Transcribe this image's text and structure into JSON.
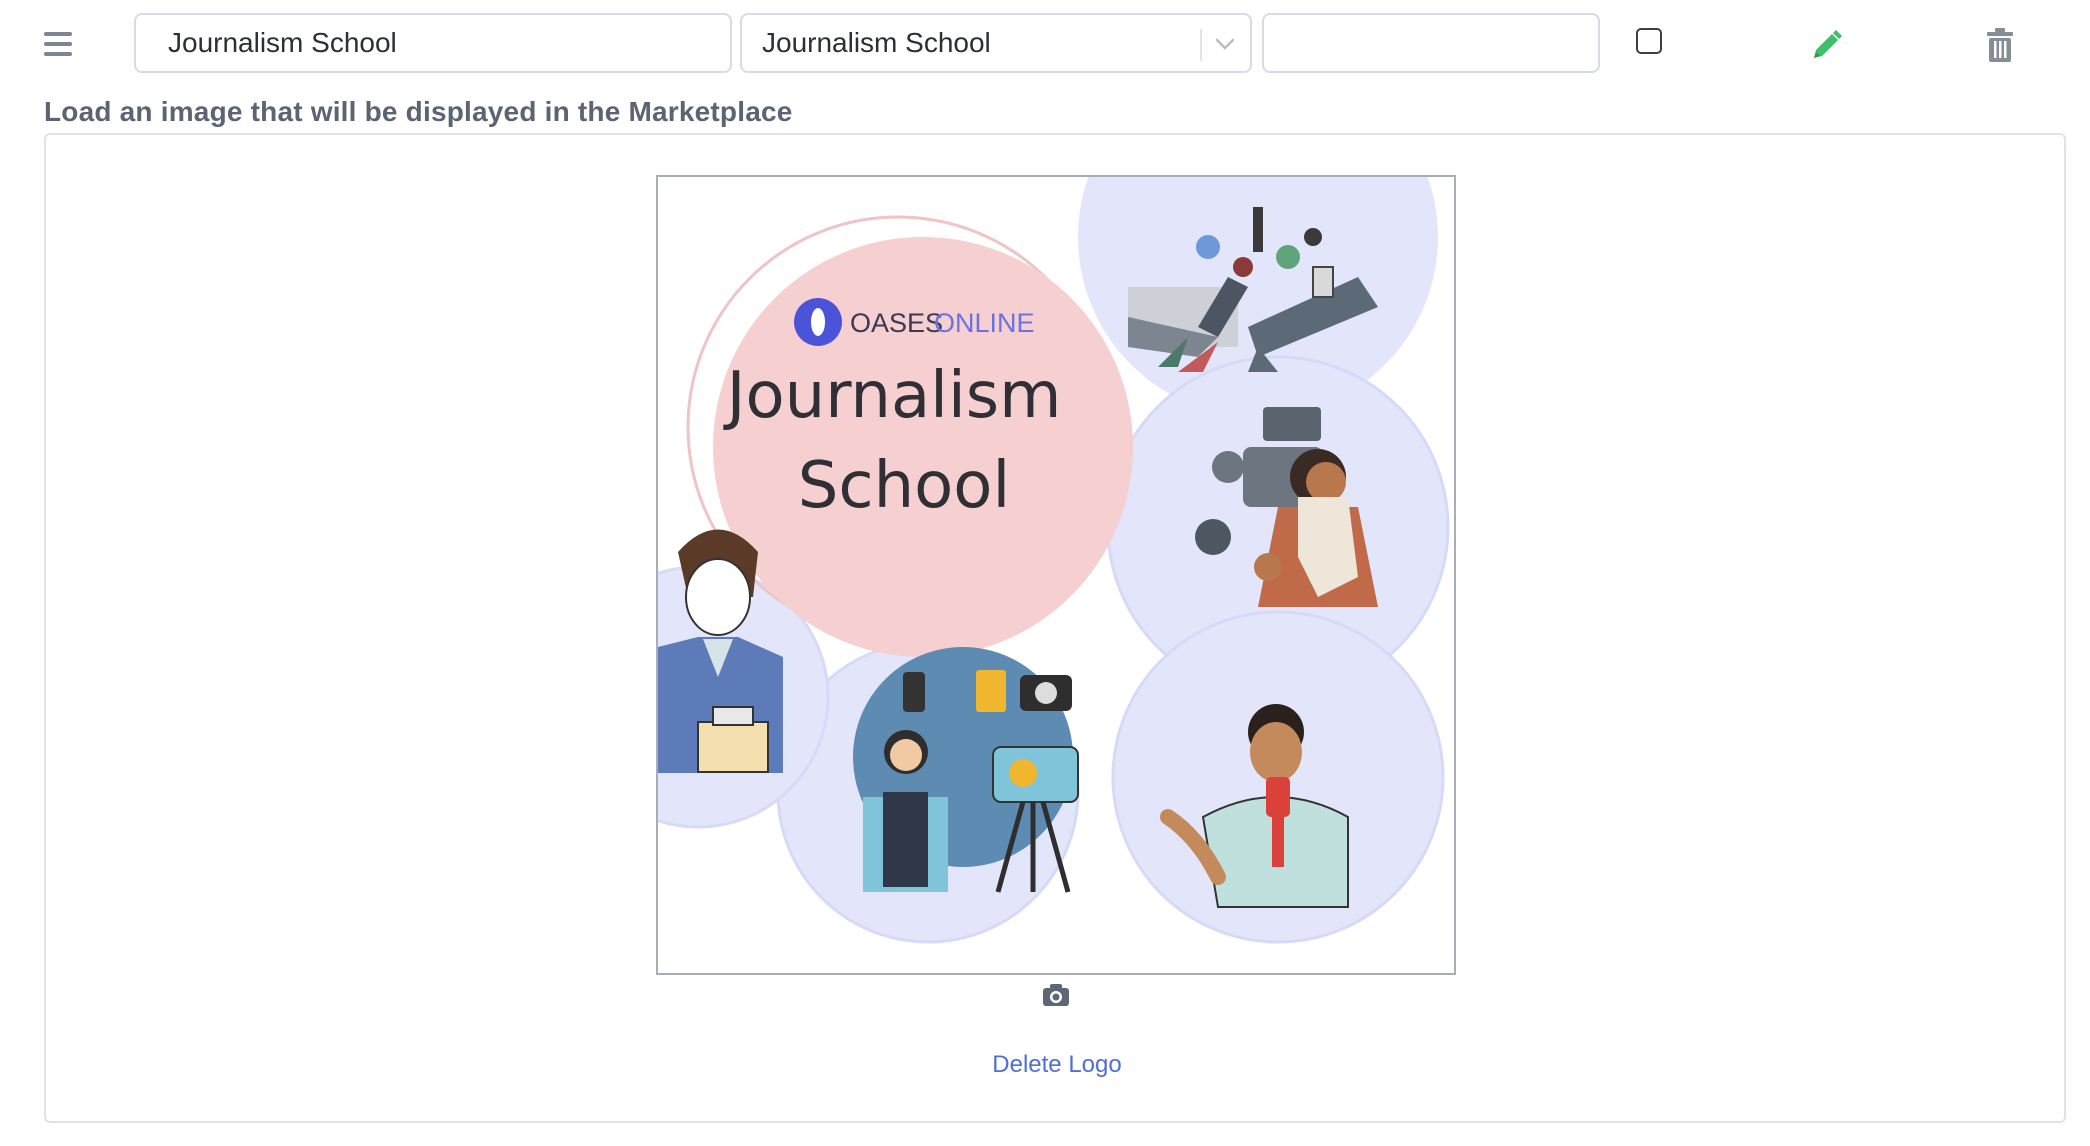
{
  "row": {
    "name_value": "Journalism School",
    "select_value": "Journalism School",
    "extra_value": "",
    "checkbox_checked": false,
    "icons": [
      "menu-icon",
      "chevron-down-icon",
      "pencil-icon",
      "trash-icon"
    ]
  },
  "upload": {
    "label": "Load an image that will be displayed in the Marketplace",
    "logo_image": {
      "brand_left": "OASES",
      "brand_right": "ONLINE",
      "title_line1": "Journalism",
      "title_line2": "School"
    },
    "delete_label": "Delete Logo",
    "camera_icon": "camera-icon"
  },
  "colors": {
    "edit_icon": "#3fbf6a",
    "link": "#4f6fd6",
    "brand_blue": "#4b54d8",
    "pink_circle": "#f6cfd0",
    "lavender_circle": "#e3e5fb"
  }
}
